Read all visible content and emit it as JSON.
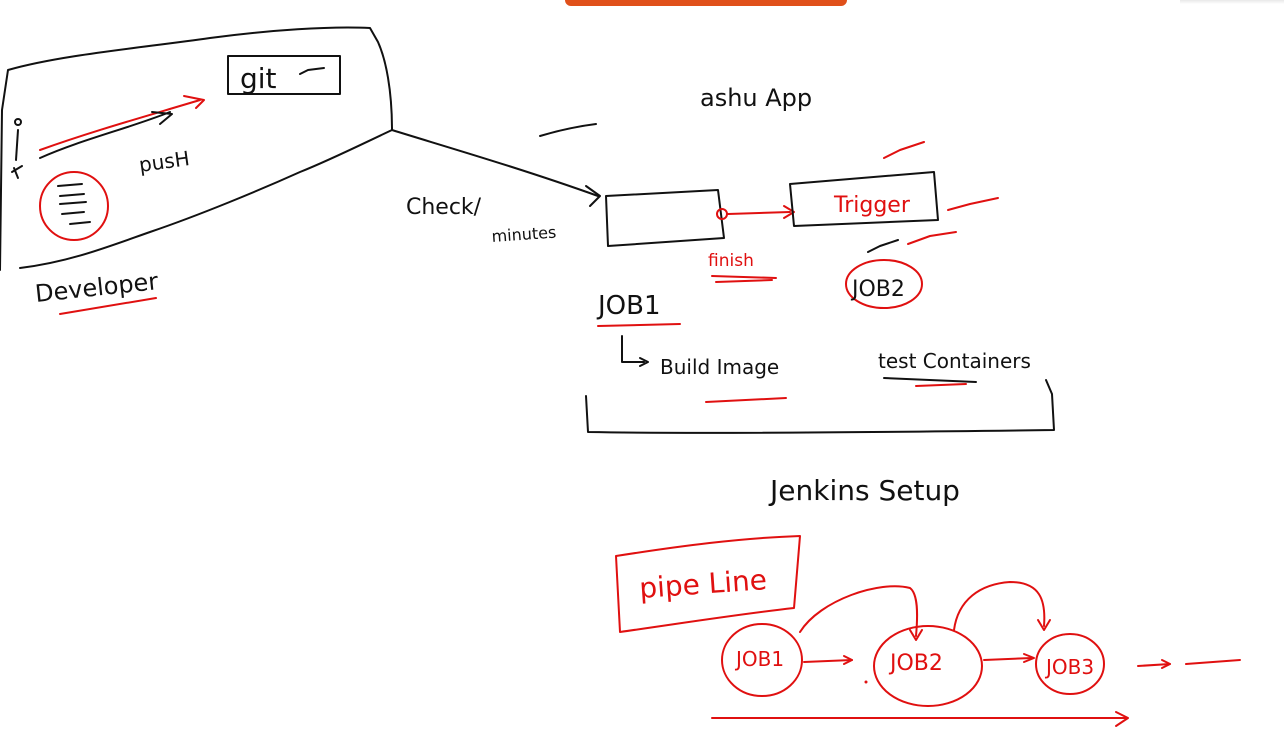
{
  "colors": {
    "ink": "#111111",
    "red": "#e01010",
    "tab": "#e0501a"
  },
  "labels": {
    "git": "git",
    "push": "pusH",
    "developer": "Developer",
    "check": "Check/",
    "minutes": "minutes",
    "app": "ashu App",
    "trigger": "Trigger",
    "finish": "finish",
    "job1": "JOB1",
    "job2": "JOB2",
    "build_image": "Build Image",
    "test_containers": "test Containers",
    "jenkins_setup": "Jenkins Setup"
  },
  "pipeline": {
    "title": "pipe Line",
    "jobs": [
      "JOB1",
      "JOB2",
      "JOB3"
    ]
  }
}
